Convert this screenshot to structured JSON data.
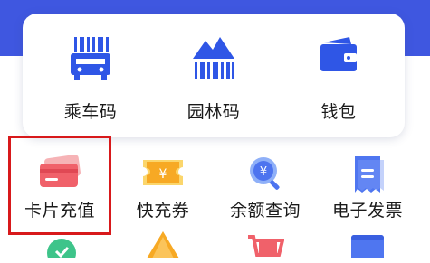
{
  "quick_access": [
    {
      "label": "乘车码",
      "icon": "bus-qr-code-icon"
    },
    {
      "label": "园林码",
      "icon": "garden-pass-icon"
    },
    {
      "label": "钱包",
      "icon": "wallet-icon"
    }
  ],
  "services": [
    {
      "label": "卡片充值",
      "icon": "card-recharge-icon"
    },
    {
      "label": "快充券",
      "icon": "quick-recharge-coupon-icon"
    },
    {
      "label": "余额查询",
      "icon": "balance-query-icon"
    },
    {
      "label": "电子发票",
      "icon": "e-invoice-icon"
    }
  ],
  "colors": {
    "brand_blue": "#3f57e0",
    "highlight_red": "#d8191b",
    "card_red": "#f0616a",
    "coupon_orange": "#f7a924",
    "invoice_blue": "#4f76f0"
  }
}
